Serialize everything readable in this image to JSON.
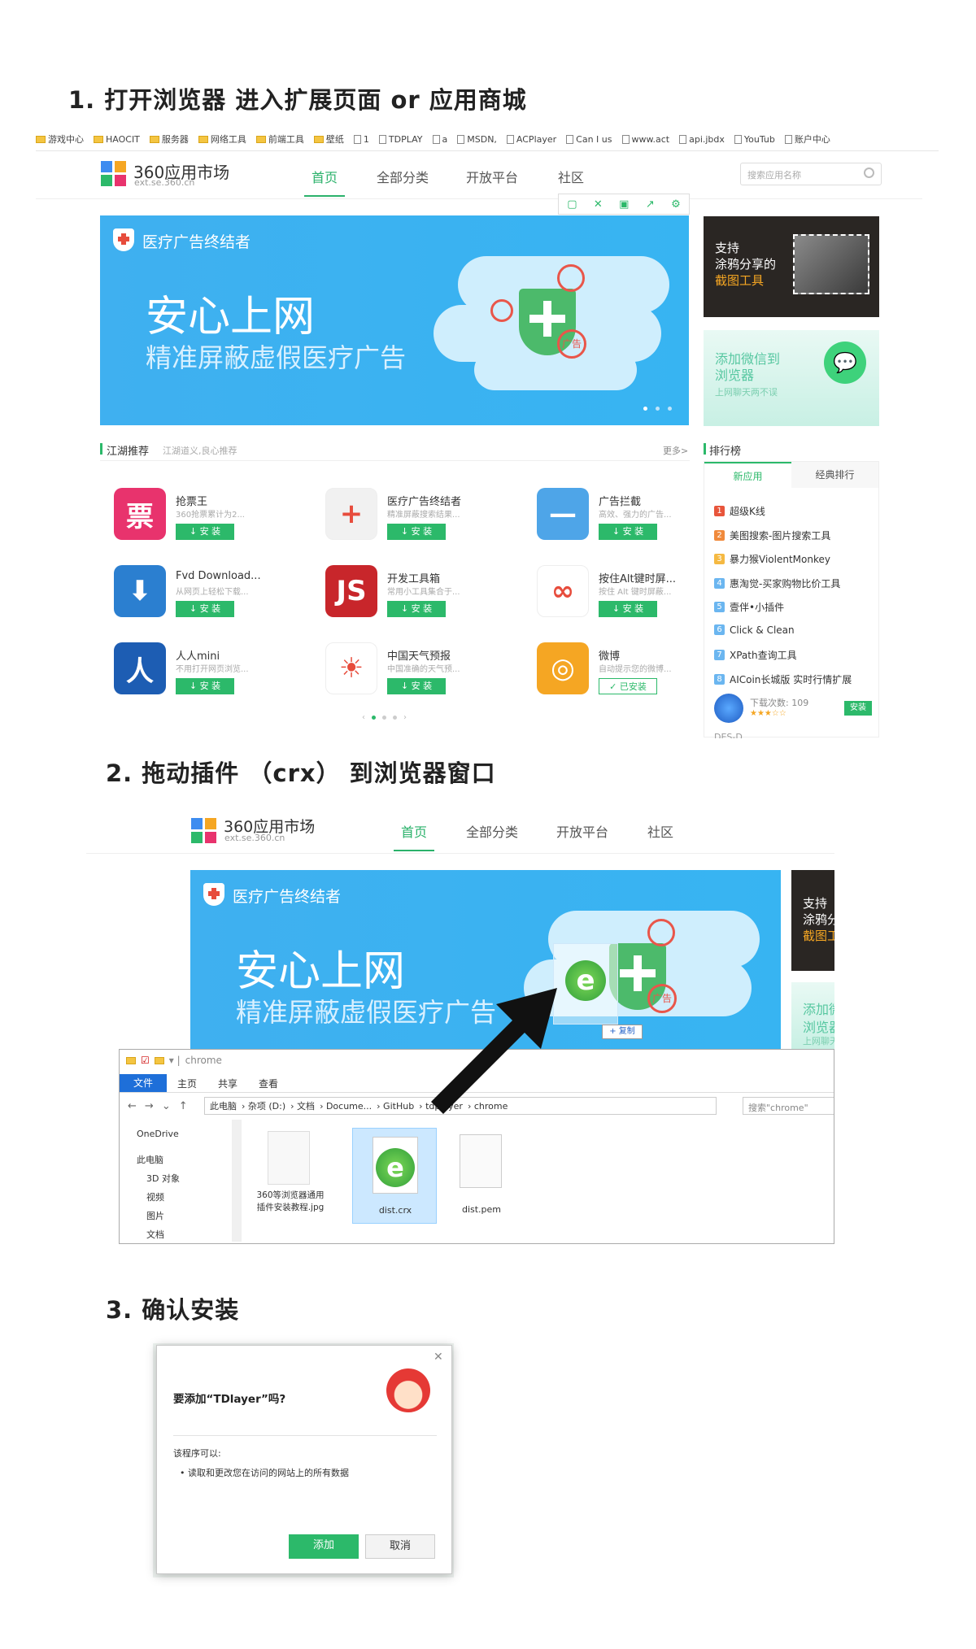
{
  "steps": {
    "step1": "1. 打开浏览器  进入扩展页面 or  应用商城",
    "step2": "2. 拖动插件  （crx）  到浏览器窗口",
    "step3": "3. 确认安装"
  },
  "bookmarks": [
    "游戏中心",
    "HAOCIT",
    "服务器",
    "网络工具",
    "前端工具",
    "壁纸",
    "1",
    "TDPLAY",
    "a",
    "MSDN,",
    "ACPlayer",
    "Can I us",
    "www.act",
    "api.jbdx",
    "YouTub",
    "账户中心"
  ],
  "store": {
    "logo_title": "360应用市场",
    "logo_url": "ext.se.360.cn",
    "nav": [
      "首页",
      "全部分类",
      "开放平台",
      "社区"
    ],
    "search_placeholder": "搜索应用名称",
    "banner": {
      "tag": "医疗广告终结者",
      "title": "安心上网",
      "subtitle": "精准屏蔽虚假医疗广告",
      "ad_word": "广告"
    },
    "side_ad1": {
      "line1": "支持",
      "line2": "涂鸦分享的",
      "line3": "截图工具"
    },
    "side_ad2": {
      "line1": "添加微信到",
      "line2": "浏览器",
      "line3": "上网聊天两不误"
    },
    "recommend_title": "江湖推荐",
    "recommend_sub": "江湖道义,良心推荐",
    "more": "更多>",
    "install_label": "安 装",
    "installed_label": "已安装",
    "apps": [
      {
        "name": "抢票王",
        "desc": "360抢票累计为2...",
        "icon": "票",
        "color": "#e8336d"
      },
      {
        "name": "医疗广告终结者",
        "desc": "精准屏蔽搜索结果...",
        "icon": "+",
        "color": "#f1f1f1"
      },
      {
        "name": "广告拦截",
        "desc": "高效、强力的广告...",
        "icon": "—",
        "color": "#4ea5e8"
      },
      {
        "name": "Fvd Download...",
        "desc": "从网页上轻松下载...",
        "icon": "⬇",
        "color": "#2b7fd0"
      },
      {
        "name": "开发工具箱",
        "desc": "常用小工具集合于...",
        "icon": "JS",
        "color": "#c8262b"
      },
      {
        "name": "按住Alt键时屏...",
        "desc": "按住 Alt 键时屏蔽...",
        "icon": "∞",
        "color": "#fff"
      },
      {
        "name": "人人mini",
        "desc": "不用打开网页浏览...",
        "icon": "人",
        "color": "#1d5db3"
      },
      {
        "name": "中国天气预报",
        "desc": "中国准确的天气预...",
        "icon": "☀",
        "color": "#fff"
      },
      {
        "name": "微博",
        "desc": "自动提示您的微博...",
        "icon": "◎",
        "color": "#f5a623"
      }
    ],
    "ranking_title": "排行榜",
    "ranking_tabs": [
      "新应用",
      "经典排行"
    ],
    "ranking": [
      "超级K线",
      "美图搜索-图片搜索工具",
      "暴力猴ViolentMonkey",
      "惠淘觉-买家购物比价工具",
      "壹伴•小插件",
      "Click & Clean",
      "XPath查询工具",
      "AICoin长城版 实时行情扩展"
    ],
    "download_label": "下载次数: 109",
    "download_install": "安装",
    "last_rank": "DES-D..."
  },
  "explorer": {
    "path_title": "chrome",
    "ribbon": [
      "文件",
      "主页",
      "共享",
      "查看"
    ],
    "breadcrumb": [
      "此电脑",
      "杂项 (D:)",
      "文档",
      "Docume...",
      "GitHub",
      "tdplayer",
      "chrome"
    ],
    "search": "搜索\"chrome\"",
    "tree": [
      "OneDrive",
      "此电脑",
      "3D 对象",
      "视频",
      "图片",
      "文档"
    ],
    "files": [
      {
        "name": "360等浏览器通用插件安装教程.jpg"
      },
      {
        "name": "dist.crx"
      },
      {
        "name": "dist.pem"
      }
    ],
    "drag_label": "+ 复制"
  },
  "dialog": {
    "question": "要添加“TDlayer”吗?",
    "can": "该程序可以:",
    "permission": "读取和更改您在访问的网站上的所有数据",
    "add": "添加",
    "cancel": "取消"
  }
}
